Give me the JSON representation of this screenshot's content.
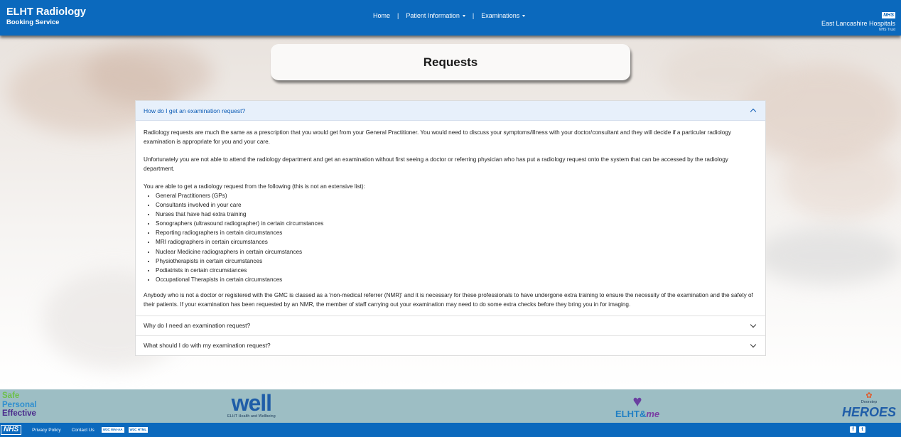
{
  "header": {
    "brand_title": "ELHT Radiology",
    "brand_subtitle": "Booking Service",
    "nav": {
      "home": "Home",
      "sep": "|",
      "patient_info": "Patient Information",
      "examinations": "Examinations"
    },
    "trust": {
      "badge": "NHS",
      "name": "East Lancashire Hospitals",
      "sub": "NHS Trust"
    }
  },
  "page_title": "Requests",
  "accordion": {
    "open_question": "How do I get an examination request?",
    "para1": "Radiology requests are much the same as a prescription that you would get from your General Practitioner. You would need to discuss your symptoms/illness with your doctor/consultant and they will decide if a particular radiology examination is appropriate for you and your care.",
    "para2": "Unfortunately you are not able to attend the radiology department and get an examination without first seeing a doctor or referring physician who has put a radiology request onto the system that can be accessed by the radiology department.",
    "list_intro": "You are able to get a radiology request from the following (this is not an extensive list):",
    "list": [
      "General Practitioners (GPs)",
      "Consultants involved in your care",
      "Nurses that have had extra training",
      "Sonographers (ultrasound radiographer) in certain circumstances",
      "Reporting radiographers in certain circumstances",
      "MRI radiographers in certain circumstances",
      "Nuclear Medicine radiographers in certain circumstances",
      "Physiotherapists in certain circumstances",
      "Podiatrists in certain circumstances",
      "Occupational Therapists in certain circumstances"
    ],
    "para3": "Anybody who is not a doctor or registered with the GMC is classed as a 'non-medical referrer (NMR)' and it is necessary for these professionals to have undergone extra training to ensure the necessity of the examination and the safety of their patients. If your examination has been requested by an NMR, the member of staff carrying out your examination may need to do some extra checks before they bring you in for imaging.",
    "closed_questions": [
      "Why do I need an examination request?",
      "What should I do with my examination request?"
    ]
  },
  "footer_logos": {
    "safe": "Safe",
    "personal": "Personal",
    "effective": "Effective",
    "well": "well",
    "well_sub": "ELHT Health and Wellbeing",
    "elht": "ELHT&",
    "me": "me",
    "heroes_top": "Doorstep",
    "heroes": "HEROES"
  },
  "footer_bar": {
    "nhs": "NHS",
    "privacy": "Privacy Policy",
    "contact": "Contact Us",
    "badge1": "W3C WAI-AA",
    "badge2": "W3C HTML"
  },
  "colors": {
    "primary": "#0b69bd",
    "accordion_open_bg": "#e7f0fb",
    "logo_strip": "#9dbec4"
  },
  "icons": {
    "nav_caret": "caret-down-icon",
    "accordion_open": "chevron-up-icon",
    "accordion_closed": "chevron-down-icon",
    "social": [
      "facebook-icon",
      "twitter-icon"
    ]
  }
}
